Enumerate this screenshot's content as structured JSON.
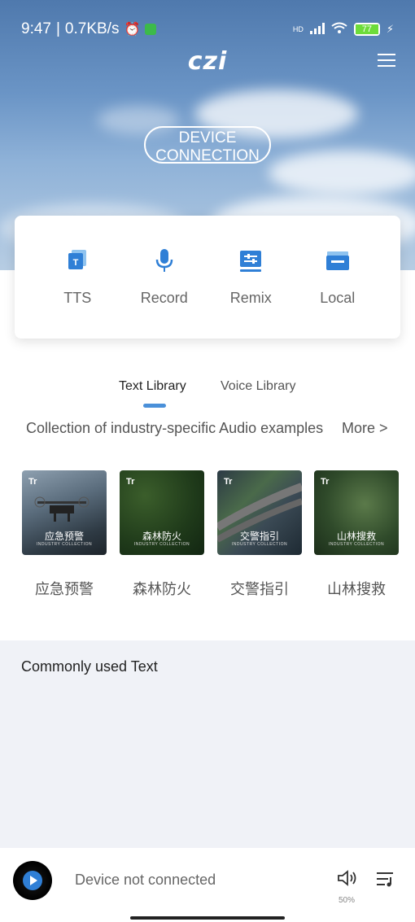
{
  "status_bar": {
    "time": "9:47",
    "speed": "0.7KB/s",
    "hd_label": "HD",
    "battery": "77"
  },
  "header": {
    "logo": "czi",
    "device_button": "DEVICE CONNECTION"
  },
  "functions": [
    {
      "label": "TTS",
      "icon": "tts-icon"
    },
    {
      "label": "Record",
      "icon": "microphone-icon"
    },
    {
      "label": "Remix",
      "icon": "remix-icon"
    },
    {
      "label": "Local",
      "icon": "local-folder-icon"
    }
  ],
  "tabs": [
    {
      "label": "Text Library",
      "active": true
    },
    {
      "label": "Voice Library",
      "active": false
    }
  ],
  "collection": {
    "description": "Collection of industry-specific Audio examples",
    "more": "More >"
  },
  "categories": [
    {
      "name": "应急预警",
      "overlay": "应急预警",
      "sub": "INDUSTRY COLLECTION",
      "badge": "Tr"
    },
    {
      "name": "森林防火",
      "overlay": "森林防火",
      "sub": "INDUSTRY COLLECTION",
      "badge": "Tr"
    },
    {
      "name": "交警指引",
      "overlay": "交警指引",
      "sub": "INDUSTRY COLLECTION",
      "badge": "Tr"
    },
    {
      "name": "山林搜救",
      "overlay": "山林搜救",
      "sub": "INDUSTRY COLLECTION",
      "badge": "Tr"
    }
  ],
  "common_text": {
    "title": "Commonly used Text"
  },
  "player": {
    "status": "Device not connected",
    "volume": "50%"
  },
  "colors": {
    "accent": "#4a90d9",
    "icon_blue": "#2f7fd6"
  }
}
